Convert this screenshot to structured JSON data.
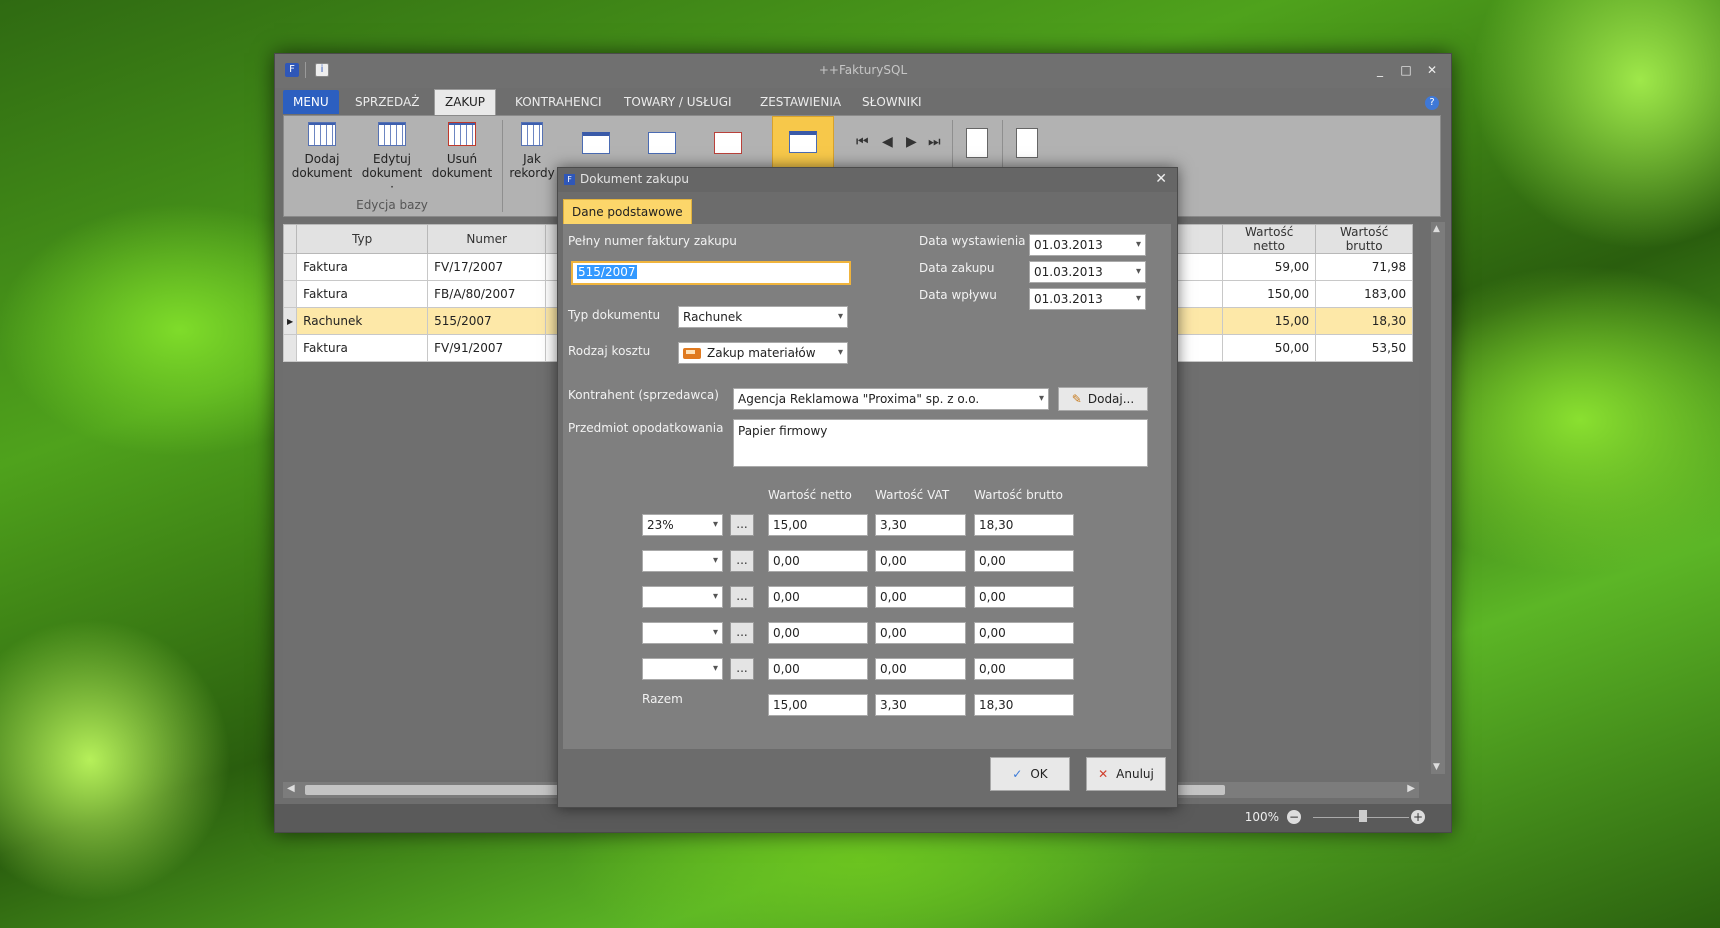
{
  "window": {
    "title": "++FakturySQL",
    "controls": [
      "_",
      "□",
      "✕"
    ]
  },
  "tabs": [
    "MENU",
    "SPRZEDAŻ",
    "ZAKUP",
    "KONTRAHENCI",
    "TOWARY / USŁUGI",
    "ZESTAWIENIA",
    "SŁOWNIKI"
  ],
  "active_tab": "ZAKUP",
  "ribbon": {
    "add": "Dodaj\ndokument",
    "edit": "Edytuj\ndokument ·",
    "delete": "Usuń\ndokument",
    "group_label": "Edycja bazy",
    "how": "Jak\nrekordy"
  },
  "grid": {
    "columns": [
      "Typ",
      "Numer",
      "Wartość netto",
      "Wartość brutto"
    ],
    "rows": [
      {
        "typ": "Faktura",
        "numer": "FV/17/2007",
        "netto": "59,00",
        "brutto": "71,98"
      },
      {
        "typ": "Faktura",
        "numer": "FB/A/80/2007",
        "netto": "150,00",
        "brutto": "183,00"
      },
      {
        "typ": "Rachunek",
        "numer": "515/2007",
        "netto": "15,00",
        "brutto": "18,30"
      },
      {
        "typ": "Faktura",
        "numer": "FV/91/2007",
        "netto": "50,00",
        "brutto": "53,50"
      }
    ],
    "selected_row": 2
  },
  "status": {
    "zoom": "100%"
  },
  "dialog": {
    "title": "Dokument zakupu",
    "tab": "Dane podstawowe",
    "invoice_label": "Pełny numer faktury zakupu",
    "invoice_value": "515/2007",
    "issue_date_label": "Data wystawienia",
    "issue_date": "01.03.2013",
    "purchase_date_label": "Data zakupu",
    "purchase_date": "01.03.2013",
    "receipt_date_label": "Data wpływu",
    "receipt_date": "01.03.2013",
    "doc_type_label": "Typ dokumentu",
    "doc_type": "Rachunek",
    "cost_type_label": "Rodzaj kosztu",
    "cost_type": "Zakup materiałów",
    "contractor_label": "Kontrahent (sprzedawca)",
    "contractor": "Agencja Reklamowa \"Proxima\" sp. z o.o.",
    "add_button": "Dodaj...",
    "subject_label": "Przedmiot opodatkowania",
    "subject": "Papier firmowy",
    "col_net": "Wartość netto",
    "col_vat": "Wartość VAT",
    "col_gross": "Wartość brutto",
    "vat_rows": [
      {
        "rate": "23%",
        "net": "15,00",
        "vat": "3,30",
        "gross": "18,30"
      },
      {
        "rate": "",
        "net": "0,00",
        "vat": "0,00",
        "gross": "0,00"
      },
      {
        "rate": "",
        "net": "0,00",
        "vat": "0,00",
        "gross": "0,00"
      },
      {
        "rate": "",
        "net": "0,00",
        "vat": "0,00",
        "gross": "0,00"
      },
      {
        "rate": "",
        "net": "0,00",
        "vat": "0,00",
        "gross": "0,00"
      }
    ],
    "total_label": "Razem",
    "total": {
      "net": "15,00",
      "vat": "3,30",
      "gross": "18,30"
    },
    "ok": "OK",
    "cancel": "Anuluj"
  }
}
